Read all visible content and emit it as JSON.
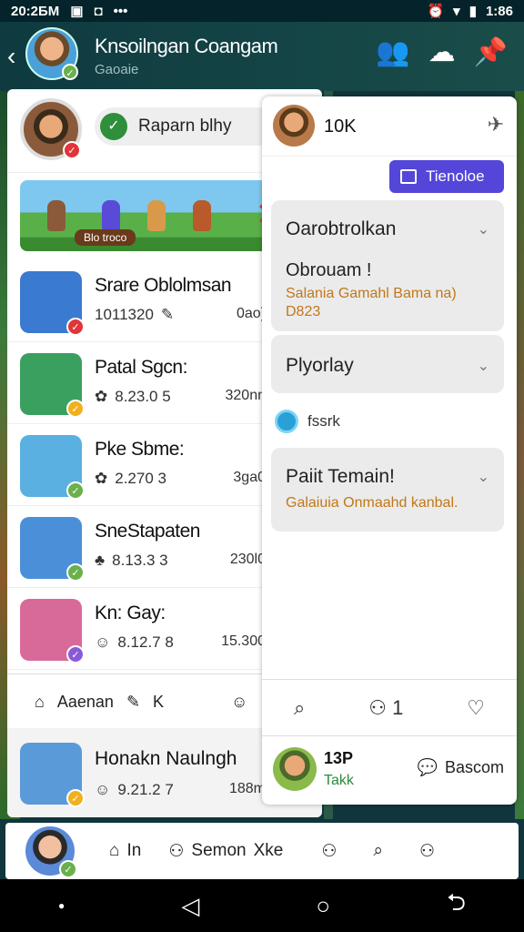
{
  "status": {
    "time_left": "20:2ƂM",
    "time_right": "1:86"
  },
  "header": {
    "title": "Knsoilngan Coangam",
    "subtitle": "Gaoaie"
  },
  "search": {
    "label": "Raparn blhy"
  },
  "banner": {
    "label": "Blo troco"
  },
  "list": [
    {
      "name": "Srare Oblolmsan",
      "meta": "1011320",
      "meta2": "0ao)",
      "badge": "red",
      "bg": "#3a7ad0"
    },
    {
      "name": "Patal Sgcn:",
      "meta": "8.23.0 5",
      "meta2": "320nn",
      "badge": "yellow",
      "bg": "#3aa060"
    },
    {
      "name": "Pke Sbme:",
      "meta": "2.270 3",
      "meta2": "3ga0",
      "badge": "green",
      "bg": "#5ab0e0"
    },
    {
      "name": "SneStapaten",
      "meta": "8.13.3 3",
      "meta2": "230l0",
      "badge": "green",
      "bg": "#4a90d8"
    },
    {
      "name": "Kn: Gay:",
      "meta": "8.12.7 8",
      "meta2": "15.300",
      "badge": "purple",
      "bg": "#d86a9a"
    }
  ],
  "actions": {
    "left_label": "Aaenan",
    "left_count": "K"
  },
  "bottom_item": {
    "name": "Honakn Naulngh",
    "meta": "9.21.2 7",
    "meta2": "188m"
  },
  "panel": {
    "count": "10K",
    "button": "Tienoloe",
    "acc1_title": "Oarobtrolkan",
    "acc1_bold": "Obrouam !",
    "acc1_sub": "Salania Gamahl Bama na)",
    "acc1_code": "D823",
    "acc2_title": "Plyorlay",
    "fsrk": "fssrk",
    "acc3_title": "Paiit Temain!",
    "acc3_sub": "Galaiuia Onmaahd kanbal.",
    "action_count": "1",
    "score": "13P",
    "take": "Takk",
    "discuss": "Bascom"
  },
  "nav": {
    "home": "In",
    "search": "Semon",
    "search2": "Xke"
  }
}
